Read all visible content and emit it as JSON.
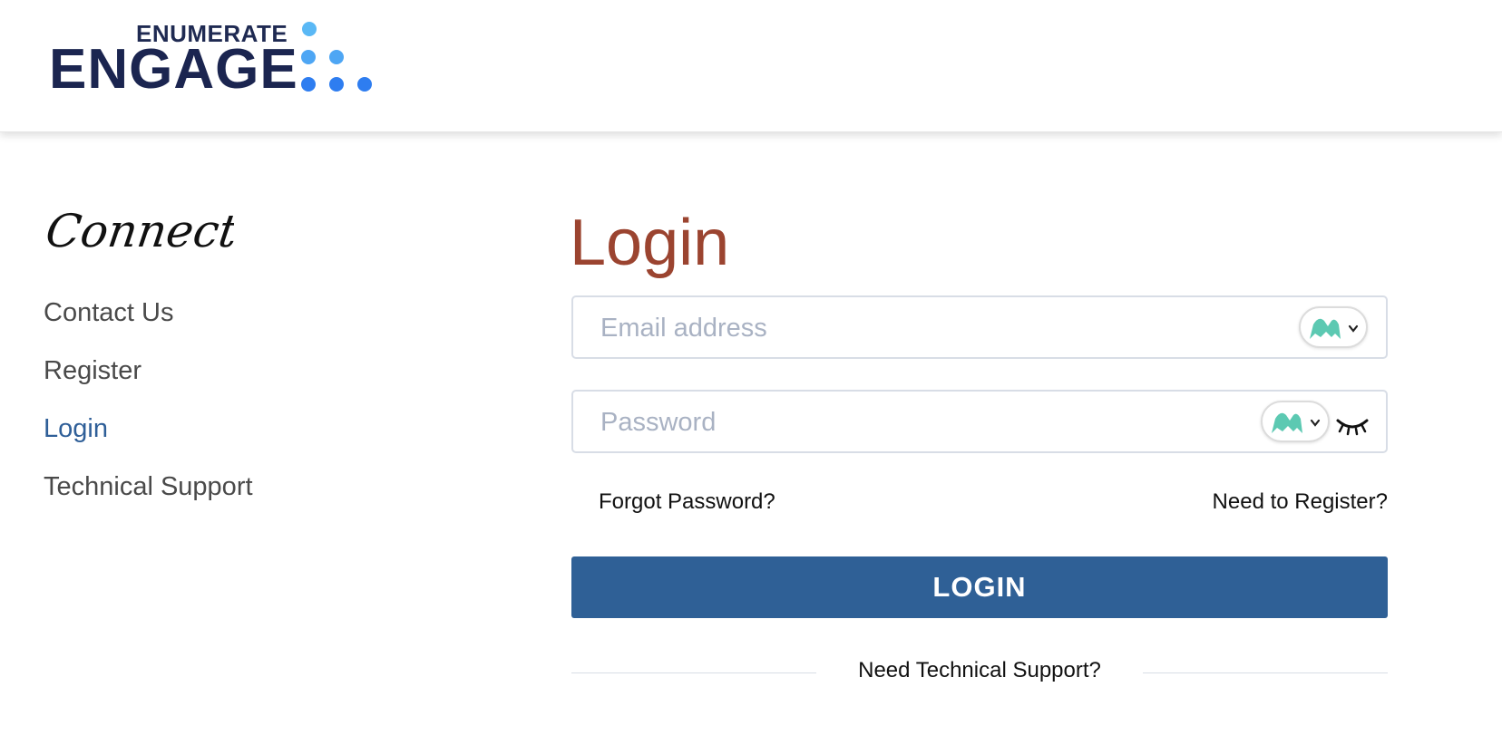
{
  "header": {
    "logo_top": "ENUMERATE",
    "logo_main": "ENGAGE",
    "colors": {
      "navy": "#1b2550",
      "dot_light": "#5ab8f5",
      "dot_blue": "#2e7df0"
    }
  },
  "sidebar": {
    "script_title": "Connect",
    "items": [
      {
        "label": "Contact Us",
        "active": false
      },
      {
        "label": "Register",
        "active": false
      },
      {
        "label": "Login",
        "active": true
      },
      {
        "label": "Technical Support",
        "active": false
      }
    ]
  },
  "main": {
    "title": "Login",
    "email": {
      "placeholder": "Email address",
      "value": ""
    },
    "password": {
      "placeholder": "Password",
      "value": "",
      "toggle_icon": "eye-closed-icon"
    },
    "password_manager_icon": "mountain-badge-icon",
    "forgot_label": "Forgot Password?",
    "register_label": "Need to Register?",
    "login_label": "LOGIN",
    "support_label": "Need Technical Support?"
  },
  "colors": {
    "title": "#9b4430",
    "button": "#2f6096",
    "active_link": "#2f5f98",
    "badge": "#5cc9b2"
  }
}
